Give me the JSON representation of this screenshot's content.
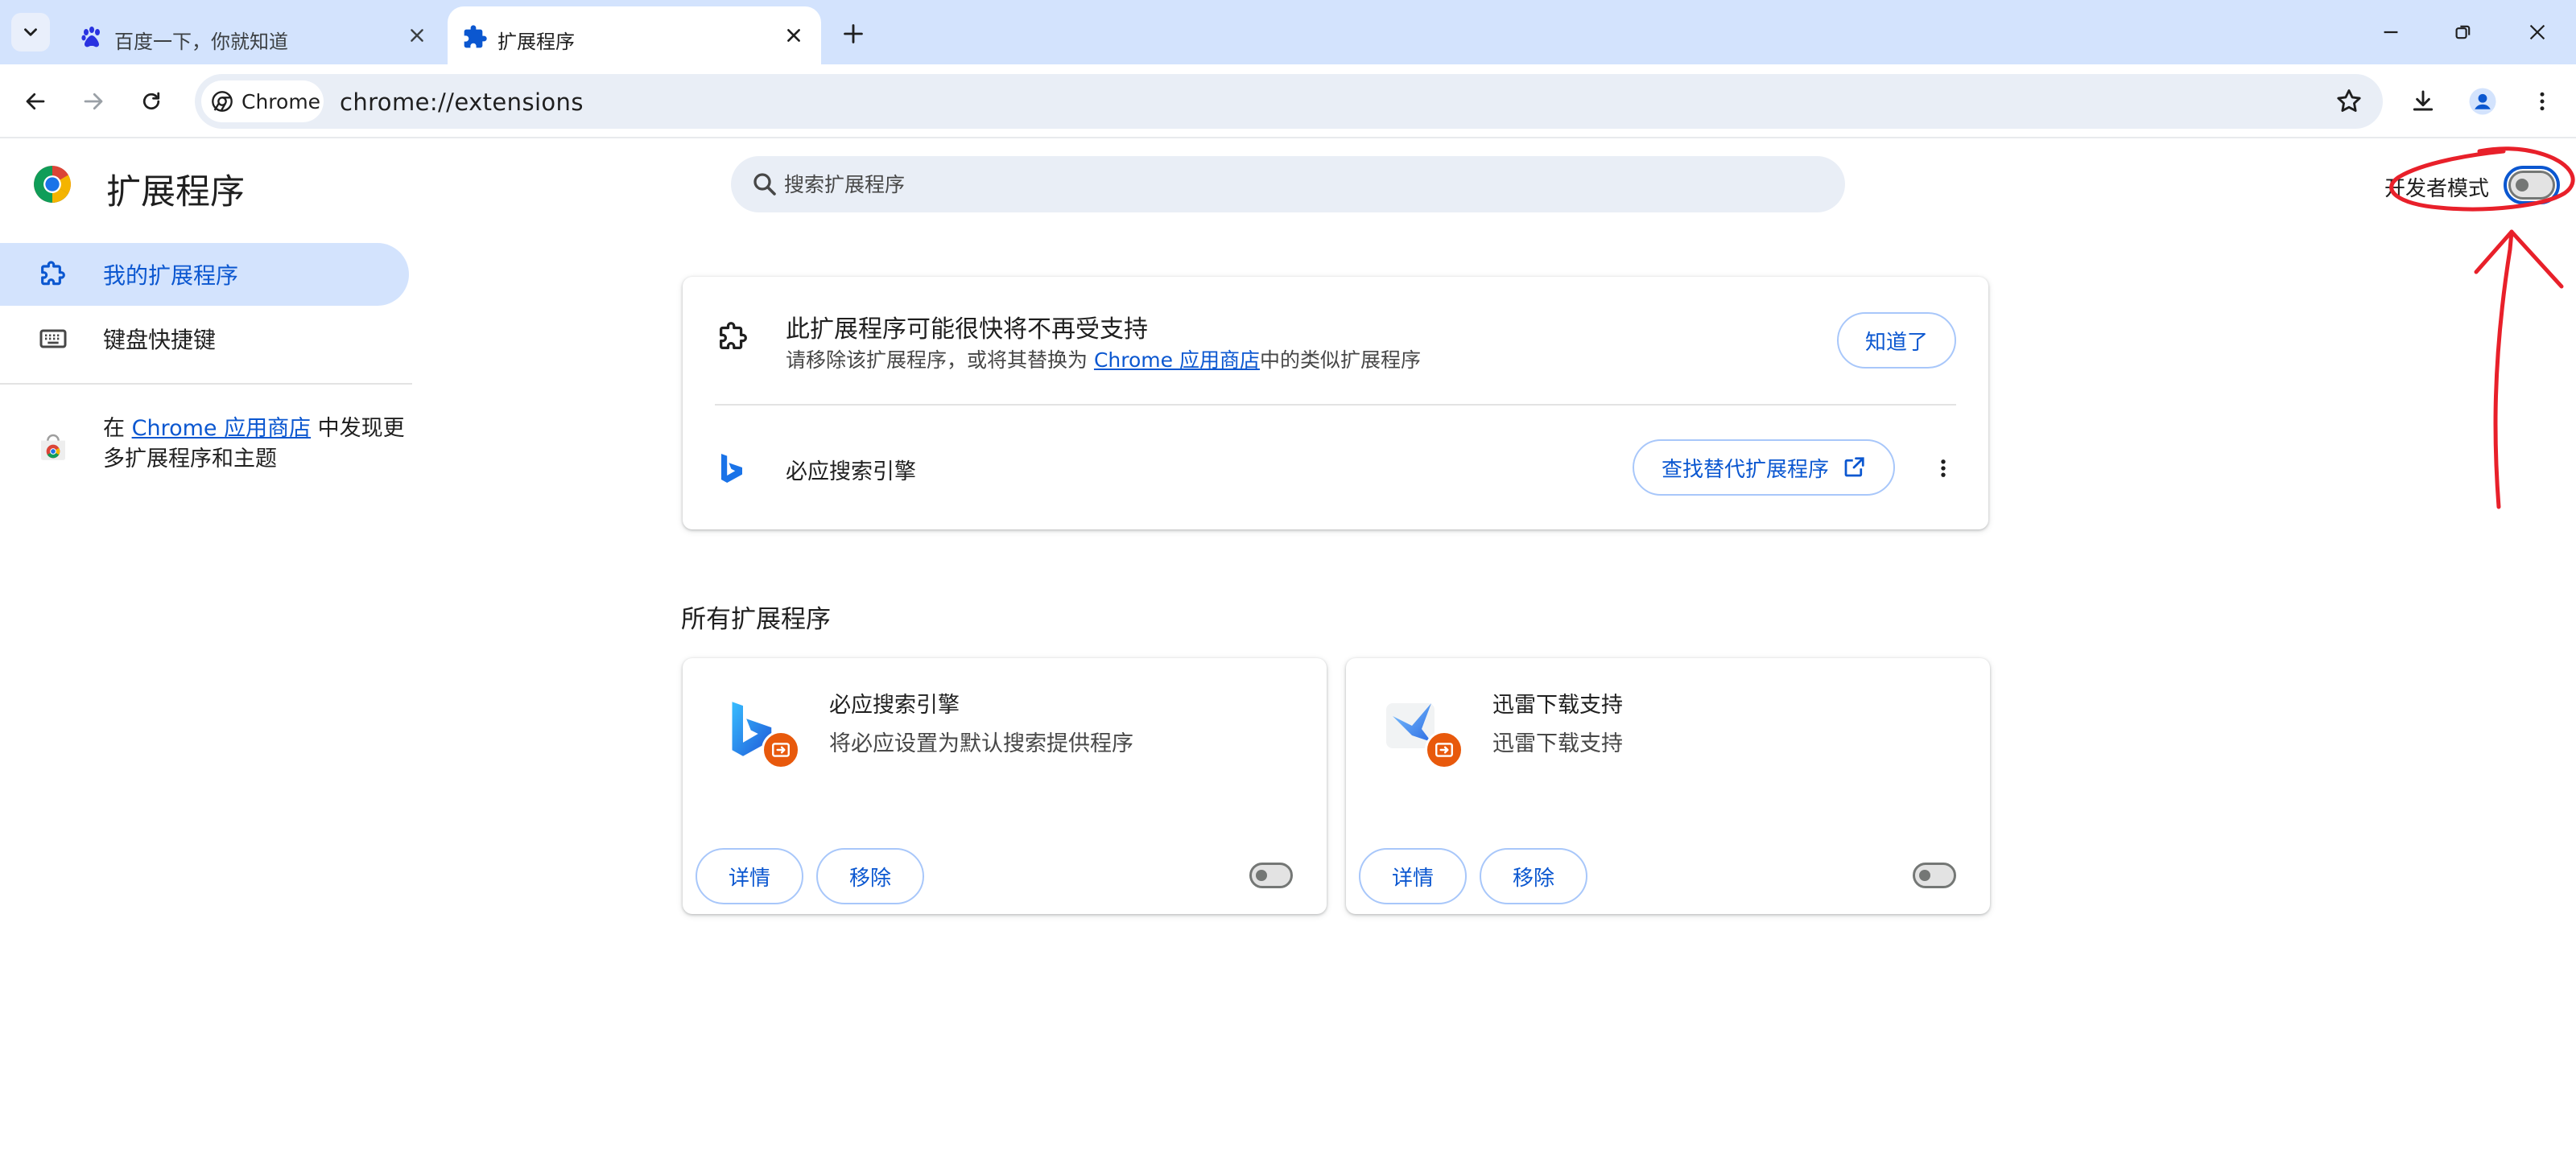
{
  "tabs": [
    {
      "title": "百度一下，你就知道",
      "active": false
    },
    {
      "title": "扩展程序",
      "active": true
    }
  ],
  "toolbar": {
    "chip_label": "Chrome",
    "url": "chrome://extensions"
  },
  "header": {
    "title": "扩展程序",
    "search_placeholder": "搜索扩展程序",
    "dev_mode_label": "开发者模式",
    "dev_mode_on": false
  },
  "sidebar": {
    "items": [
      {
        "label": "我的扩展程序",
        "active": true
      },
      {
        "label": "键盘快捷键",
        "active": false
      }
    ],
    "promo_prefix": "在 ",
    "promo_link": "Chrome 应用商店",
    "promo_suffix": " 中发现更多扩展程序和主题"
  },
  "warning": {
    "title": "此扩展程序可能很快将不再受支持",
    "desc_prefix": "请移除该扩展程序，或将其替换为 ",
    "desc_link": "Chrome 应用商店",
    "desc_suffix": "中的类似扩展程序",
    "got_it": "知道了",
    "extension_name": "必应搜索引擎",
    "find_alternative": "查找替代扩展程序"
  },
  "section_title": "所有扩展程序",
  "extensions": [
    {
      "name": "必应搜索引擎",
      "description": "将必应设置为默认搜索提供程序",
      "details": "详情",
      "remove": "移除",
      "enabled": false
    },
    {
      "name": "迅雷下载支持",
      "description": "迅雷下载支持",
      "details": "详情",
      "remove": "移除",
      "enabled": false
    }
  ],
  "colors": {
    "accent": "#0b57d0",
    "tabstrip": "#d3e3fd",
    "badge": "#e8590c",
    "annotation": "#e8202a"
  }
}
